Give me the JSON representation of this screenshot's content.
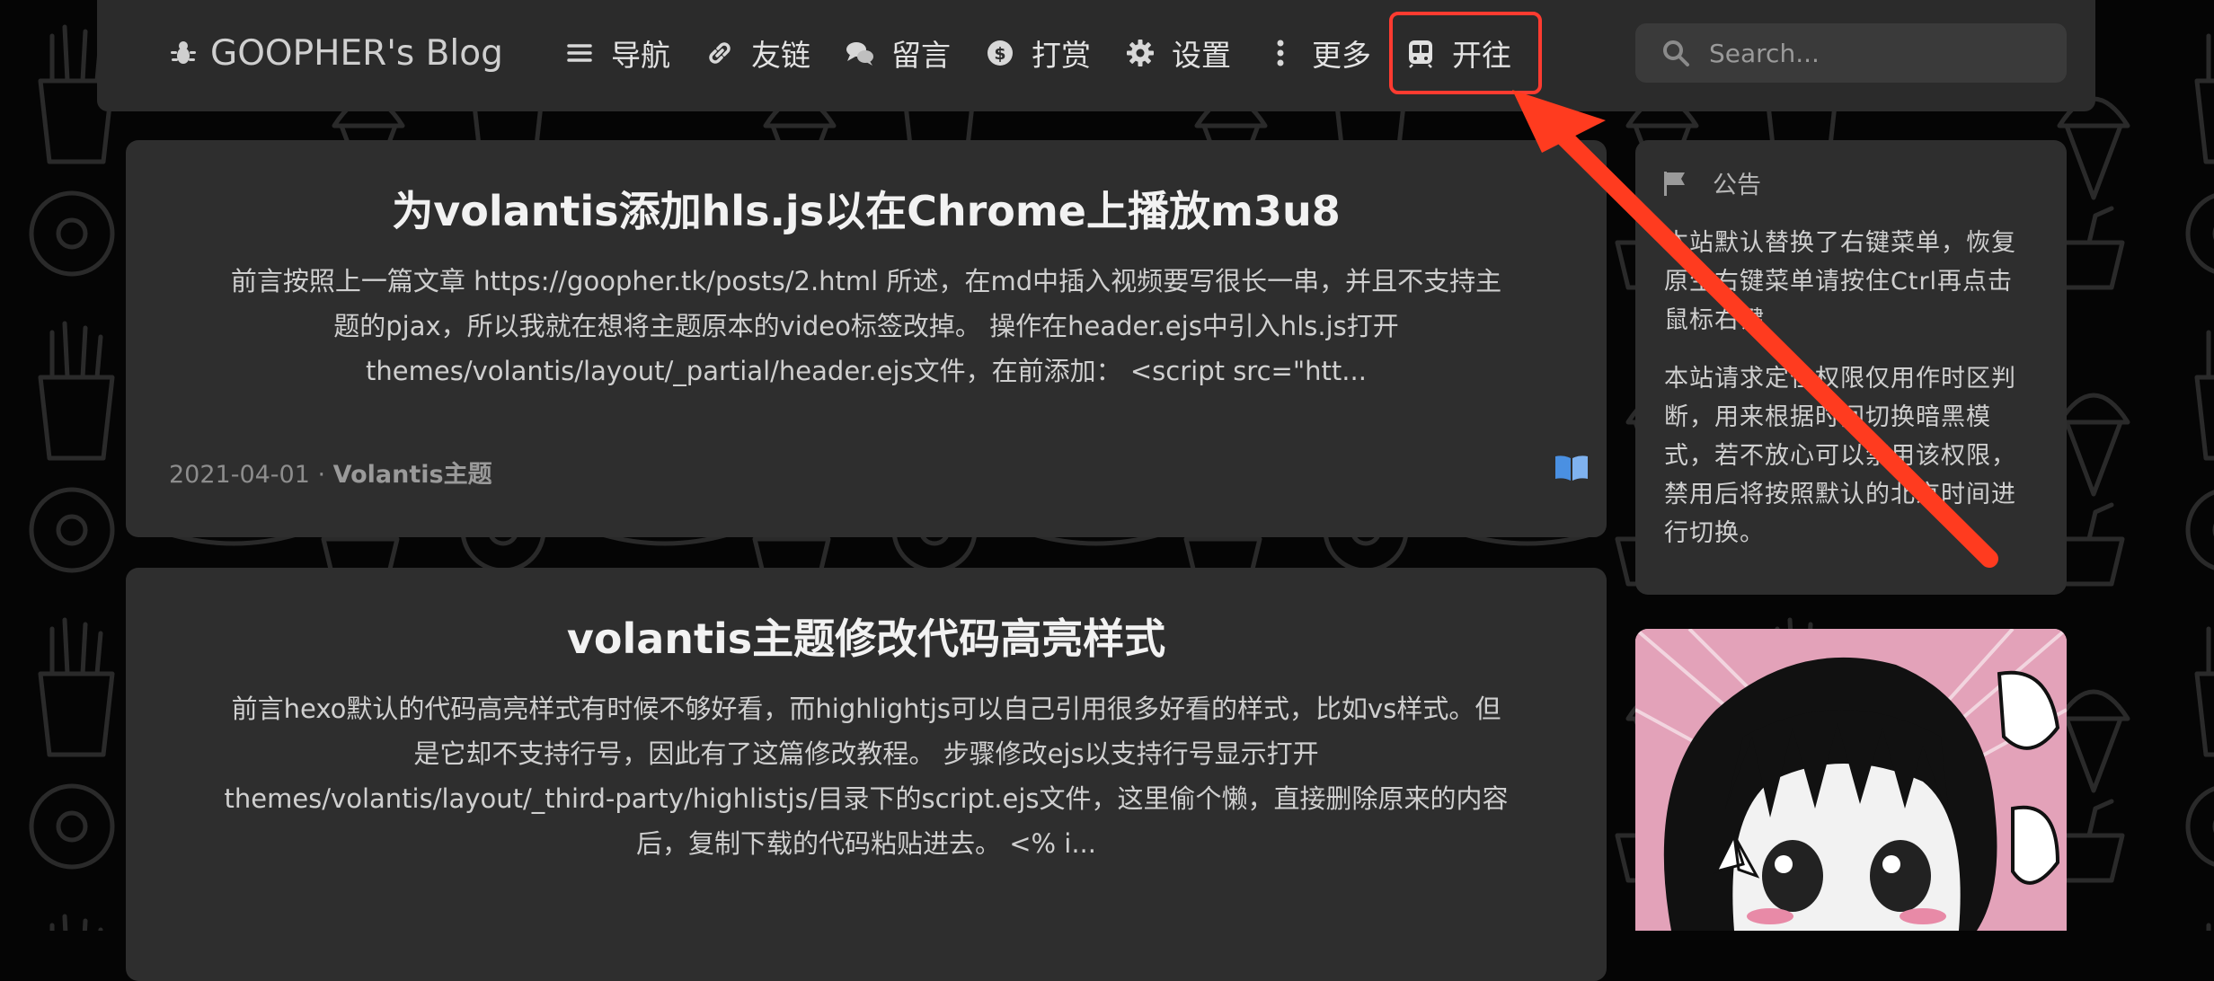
{
  "header": {
    "brand": "GOOPHER's Blog",
    "brand_icon": "bug-icon",
    "nav": [
      {
        "label": "导航",
        "icon": "menu-icon"
      },
      {
        "label": "友链",
        "icon": "link-icon"
      },
      {
        "label": "留言",
        "icon": "comments-icon"
      },
      {
        "label": "打赏",
        "icon": "dollar-icon"
      },
      {
        "label": "设置",
        "icon": "gear-icon"
      },
      {
        "label": "更多",
        "icon": "more-vertical-icon"
      },
      {
        "label": "开往",
        "icon": "subway-icon"
      }
    ],
    "search_placeholder": "Search..."
  },
  "posts": [
    {
      "title": "为volantis添加hls.js以在Chrome上播放m3u8",
      "excerpt_lines": [
        "前言按照上一篇文章 https://goopher.tk/posts/2.html 所述，在md中插入视频要写很长一串，并且不支持主",
        "题的pjax，所以我就在想将主题原本的video标签改掉。 操作在header.ejs中引入hls.js打开",
        "themes/volantis/layout/_partial/header.ejs文件，在前添加： <script src=\"htt..."
      ],
      "date": "2021-04-01",
      "separator": " · ",
      "category": "Volantis主题"
    },
    {
      "title": "volantis主题修改代码高亮样式",
      "excerpt_lines": [
        "前言hexo默认的代码高亮样式有时候不够好看，而highlightjs可以自己引用很多好看的样式，比如vs样式。但",
        "是它却不支持行号，因此有了这篇修改教程。 步骤修改ejs以支持行号显示打开",
        "themes/volantis/layout/_third-party/highlistjs/目录下的script.ejs文件，这里偷个懒，直接删除原来的内容",
        "后，复制下载的代码粘贴进去。 <% i..."
      ]
    }
  ],
  "sidebar": {
    "notice_title": "公告",
    "notice_icon": "flag-icon",
    "notice_paragraphs": [
      "本站默认替换了右键菜单，恢复原生右键菜单请按住Ctrl再点击鼠标右键",
      "本站请求定位权限仅用作时区判断，用来根据时间切换暗黑模式，若不放心可以禁用该权限，禁用后将按照默认的北京时间进行切换。"
    ]
  },
  "colors": {
    "highlight": "#ff3b30",
    "arrow": "#ff3b1f",
    "card": "#2e2e2e",
    "header": "#2b2b2b",
    "book": "#4a90e2"
  }
}
